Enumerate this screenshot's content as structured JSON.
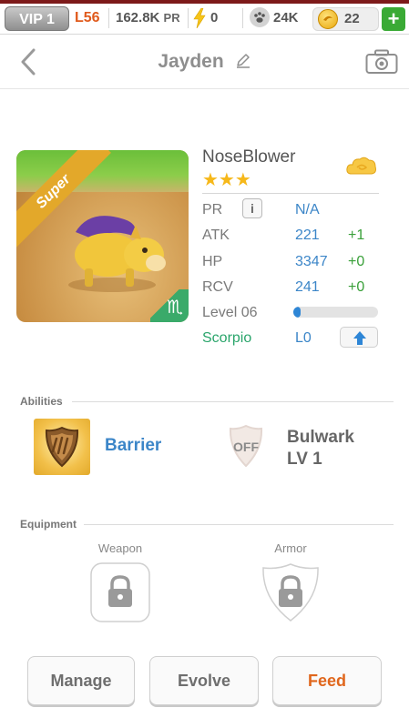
{
  "statusbar": {
    "vip": "VIP 1",
    "level": "L56",
    "pr_value": "162.8K",
    "pr_unit": "PR",
    "energy": "0",
    "food": "24K",
    "coins": "22",
    "add": "+"
  },
  "nav": {
    "title": "Jayden"
  },
  "pet": {
    "rarity": "Super",
    "zodiac_symbol": "♏",
    "name": "NoseBlower",
    "stars": "★★★",
    "star_count": 3,
    "stats": {
      "pr_label": "PR",
      "pr_info": "i",
      "pr_value": "N/A",
      "atk_label": "ATK",
      "atk_value": "221",
      "atk_bonus": "+1",
      "hp_label": "HP",
      "hp_value": "3347",
      "hp_bonus": "+0",
      "rcv_label": "RCV",
      "rcv_value": "241",
      "rcv_bonus": "+0",
      "level_label": "Level 06",
      "level_progress": 0.05,
      "zodiac_label": "Scorpio",
      "zodiac_level": "L0"
    }
  },
  "abilities": {
    "title": "Abilities",
    "primary": "Barrier",
    "secondary_state": "OFF",
    "secondary_name": "Bulwark",
    "secondary_level": "LV 1"
  },
  "equipment": {
    "title": "Equipment",
    "weapon_label": "Weapon",
    "armor_label": "Armor"
  },
  "actions": {
    "manage": "Manage",
    "evolve": "Evolve",
    "feed": "Feed"
  },
  "colors": {
    "accent_blue": "#3c86c8",
    "bonus_green": "#3aa03a",
    "zodiac_green": "#2aa56b",
    "feed_orange": "#e0661c",
    "level_orange": "#e05a1c"
  }
}
